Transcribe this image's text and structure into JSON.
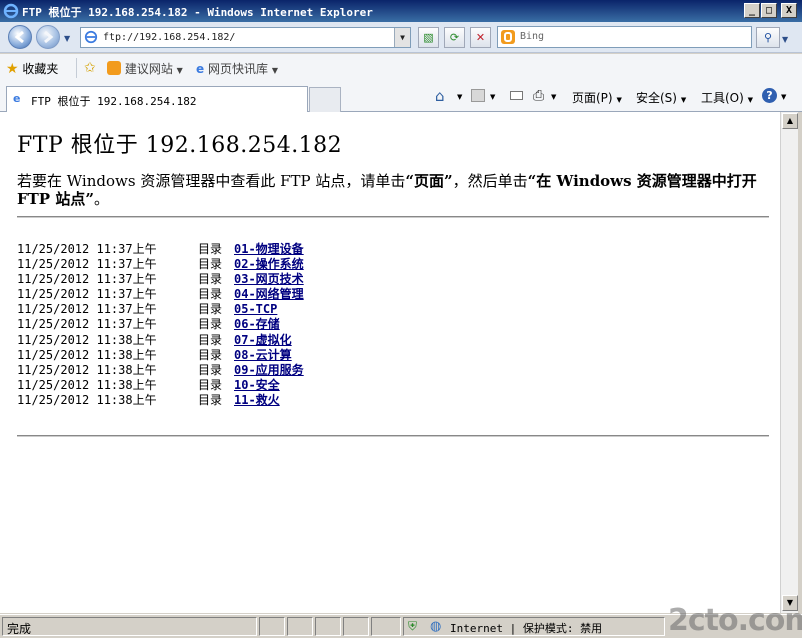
{
  "window": {
    "title": "FTP 根位于 192.168.254.182 - Windows Internet Explorer",
    "minimize": "_",
    "maximize": "□",
    "close": "X"
  },
  "address": {
    "url": "ftp://192.168.254.182/",
    "search_placeholder": "Bing"
  },
  "favorites": {
    "label": "收藏夹",
    "items": [
      "建议网站",
      "网页快讯库"
    ]
  },
  "tab": {
    "title": "FTP 根位于 192.168.254.182"
  },
  "commandbar": {
    "page": "页面(P)",
    "safety": "安全(S)",
    "tools": "工具(O)"
  },
  "page": {
    "heading": "FTP 根位于 192.168.254.182",
    "intro_prefix": "若要在 Windows 资源管理器中查看此 FTP 站点，请单击",
    "intro_page": "“页面”",
    "intro_middle": "，然后单击",
    "intro_open": "“在 Windows 资源管理器中打开 FTP 站点”",
    "intro_end": "。",
    "entries": [
      {
        "date": "11/25/2012 11:37上午",
        "type": "目录",
        "name": "01-物理设备"
      },
      {
        "date": "11/25/2012 11:37上午",
        "type": "目录",
        "name": "02-操作系统"
      },
      {
        "date": "11/25/2012 11:37上午",
        "type": "目录",
        "name": "03-网页技术"
      },
      {
        "date": "11/25/2012 11:37上午",
        "type": "目录",
        "name": "04-网络管理"
      },
      {
        "date": "11/25/2012 11:37上午",
        "type": "目录",
        "name": "05-TCP"
      },
      {
        "date": "11/25/2012 11:37上午",
        "type": "目录",
        "name": "06-存储"
      },
      {
        "date": "11/25/2012 11:38上午",
        "type": "目录",
        "name": "07-虚拟化"
      },
      {
        "date": "11/25/2012 11:38上午",
        "type": "目录",
        "name": "08-云计算"
      },
      {
        "date": "11/25/2012 11:38上午",
        "type": "目录",
        "name": "09-应用服务"
      },
      {
        "date": "11/25/2012 11:38上午",
        "type": "目录",
        "name": "10-安全"
      },
      {
        "date": "11/25/2012 11:38上午",
        "type": "目录",
        "name": "11-救火"
      }
    ]
  },
  "status": {
    "text": "完成",
    "zone": "Internet | 保护模式: 禁用",
    "watermark": "2cto.com"
  },
  "colors": {
    "title_bar": "#0a246a",
    "link": "#000080"
  }
}
